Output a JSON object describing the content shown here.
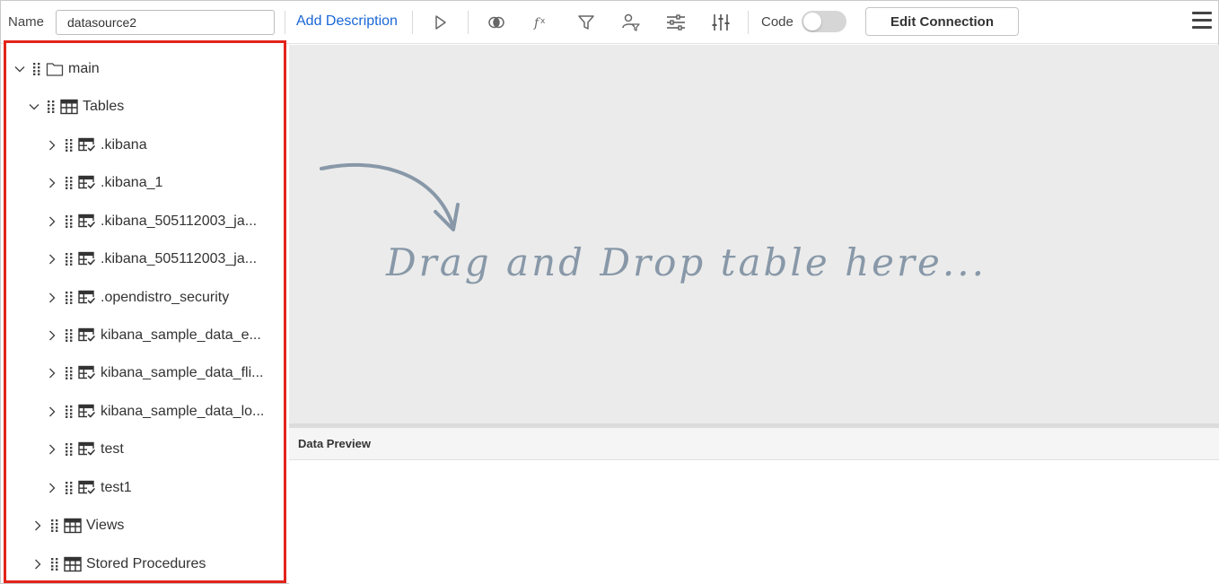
{
  "toolbar": {
    "name_label": "Name",
    "name_value": "datasource2",
    "add_description": "Add Description",
    "code_label": "Code",
    "code_enabled": false,
    "edit_connection": "Edit Connection",
    "icons": [
      "play-icon",
      "join-icon",
      "formula-icon",
      "filter-icon",
      "user-filter-icon",
      "settings-sliders-icon",
      "equalizer-icon",
      "hamburger-menu-icon"
    ]
  },
  "tree": {
    "root": {
      "label": "main",
      "expanded": true
    },
    "tables_folder": {
      "label": "Tables",
      "expanded": true
    },
    "tables": [
      ".kibana",
      ".kibana_1",
      ".kibana_505112003_ja...",
      ".kibana_505112003_ja...",
      ".opendistro_security",
      "kibana_sample_data_e...",
      "kibana_sample_data_fli...",
      "kibana_sample_data_lo...",
      "test",
      "test1"
    ],
    "views_folder": {
      "label": "Views",
      "expanded": false
    },
    "procedures_folder": {
      "label": "Stored Procedures",
      "expanded": false
    }
  },
  "canvas": {
    "drop_hint": "Drag and Drop table here..."
  },
  "preview": {
    "title": "Data Preview"
  },
  "colors": {
    "accent": "#1a66d6",
    "highlight_border": "#e2231a",
    "canvas_bg": "#ebebeb",
    "hint_text": "#8898a8"
  }
}
